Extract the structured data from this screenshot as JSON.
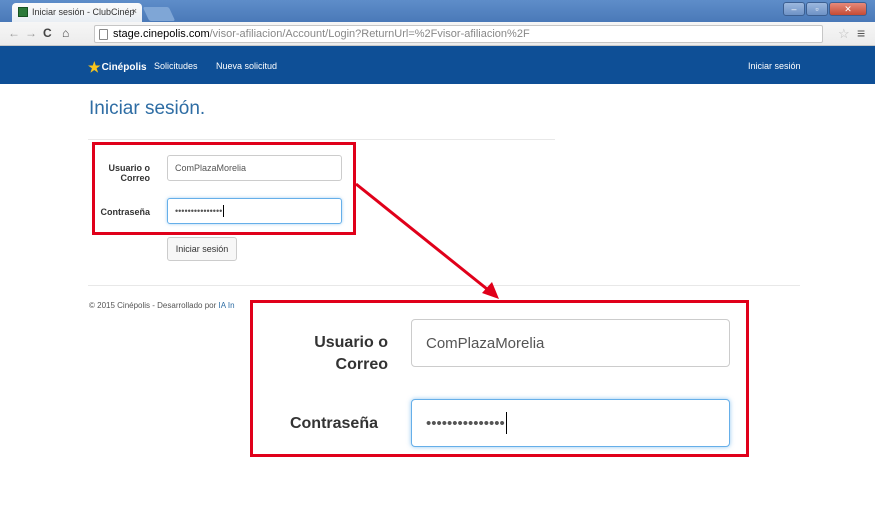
{
  "browser": {
    "tab_title": "Iniciar sesión - ClubCinép",
    "tab_close": "×",
    "url_host": "stage.cinepolis.com",
    "url_path": "/visor-afiliacion/Account/Login?ReturnUrl=%2Fvisor-afiliacion%2F"
  },
  "navbar": {
    "brand": "Cinépolis",
    "links": [
      "Solicitudes",
      "Nueva solicitud"
    ],
    "login": "Iniciar sesión"
  },
  "page": {
    "heading": "Iniciar sesión.",
    "user_label": "Usuario o Correo",
    "user_value": "ComPlazaMorelia",
    "password_label": "Contraseña",
    "password_value": "•••••••••••••••",
    "submit": "Iniciar sesión",
    "footer_text": "© 2015 Cinépolis - Desarrollado por ",
    "footer_link": "IA In"
  },
  "zoom": {
    "user_label": "Usuario o Correo",
    "user_value": "ComPlazaMorelia",
    "password_label": "Contraseña",
    "password_value": "•••••••••••••••"
  },
  "colors": {
    "navbar": "#0e4f96",
    "heading": "#2e6da4",
    "highlight": "#e0001a"
  }
}
